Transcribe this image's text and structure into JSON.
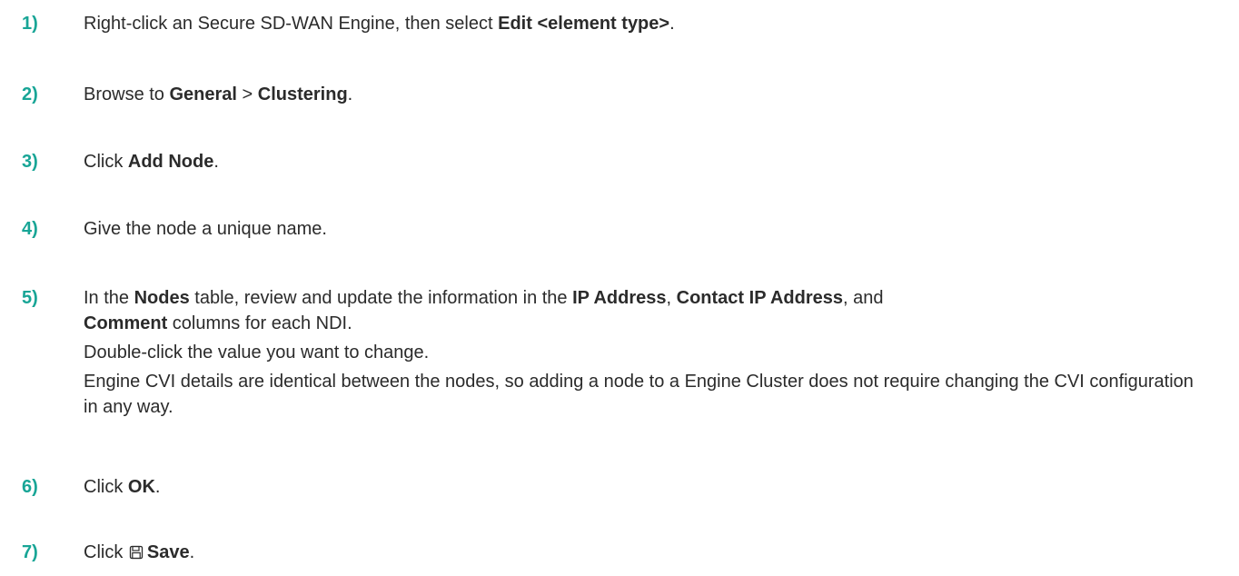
{
  "steps": [
    {
      "number": "1)",
      "before": "Right-click an Secure SD-WAN Engine, then select ",
      "bold": "Edit <element type>",
      "after": "."
    },
    {
      "number": "2)",
      "before": "Browse to ",
      "bold1": "General",
      "middle": " > ",
      "bold2": "Clustering",
      "after": "."
    },
    {
      "number": "3)",
      "before": "Click ",
      "bold": "Add Node",
      "after": "."
    },
    {
      "number": "4)",
      "text": "Give the node a unique name."
    },
    {
      "number": "5)",
      "t1": "In the ",
      "b1": "Nodes",
      "t2": " table, review and update the information in the ",
      "b2": "IP Address",
      "t3": ", ",
      "b3": "Contact IP Address",
      "t4": ", and",
      "b4": "Comment",
      "t5": " columns for each NDI.",
      "para1": "Double-click the value you want to change.",
      "para2": "Engine CVI details are identical between the nodes, so adding a node to a Engine Cluster does not require changing the CVI configuration in any way."
    },
    {
      "number": "6)",
      "before": "Click ",
      "bold": "OK",
      "after": "."
    },
    {
      "number": "7)",
      "before": "Click ",
      "icon": "save-icon",
      "bold": "Save",
      "after": "."
    }
  ]
}
